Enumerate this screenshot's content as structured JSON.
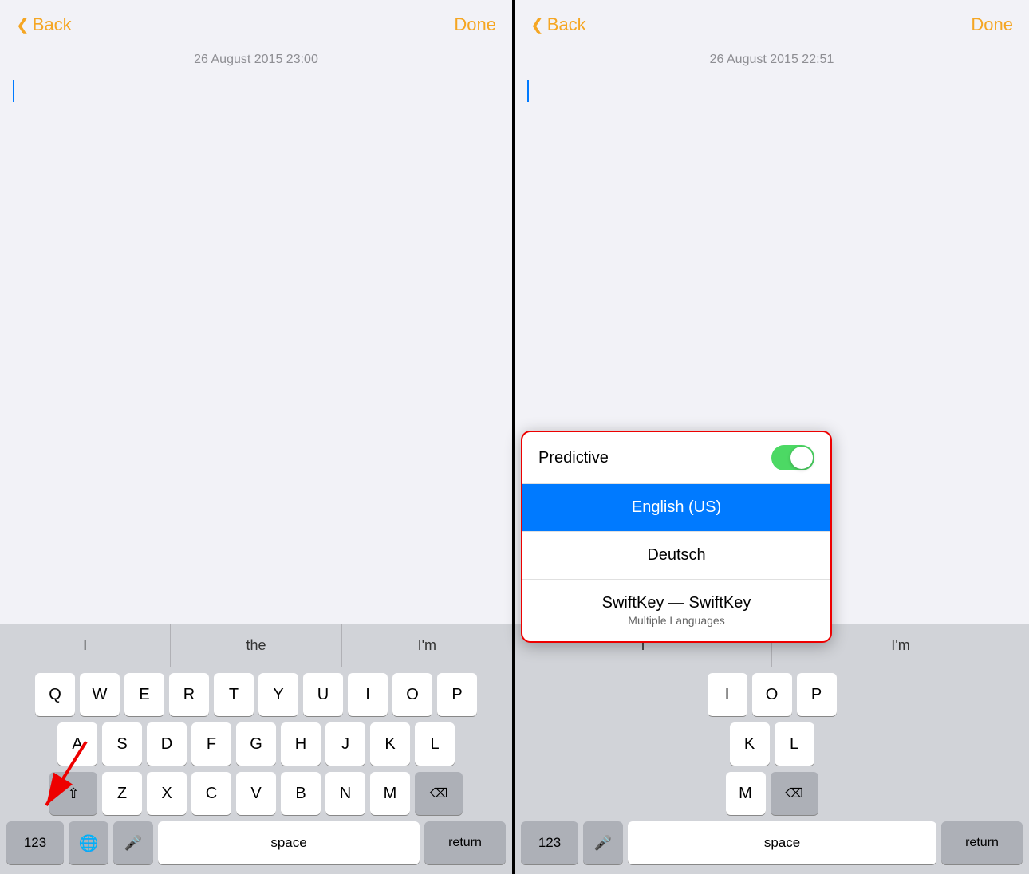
{
  "left_panel": {
    "back_label": "Back",
    "done_label": "Done",
    "date": "26 August 2015 23:00",
    "predictive_words": [
      "I",
      "the",
      "I'm"
    ],
    "keyboard_rows": [
      [
        "Q",
        "W",
        "E",
        "R",
        "T",
        "Y",
        "U",
        "I",
        "O",
        "P"
      ],
      [
        "A",
        "S",
        "D",
        "F",
        "G",
        "H",
        "J",
        "K",
        "L"
      ],
      [
        "Z",
        "X",
        "C",
        "V",
        "B",
        "N",
        "M"
      ]
    ],
    "bottom_keys": {
      "numbers": "123",
      "space": "space",
      "return": "return"
    }
  },
  "right_panel": {
    "back_label": "Back",
    "done_label": "Done",
    "date": "26 August 2015 22:51",
    "predictive_words": [
      "I",
      "I'm"
    ],
    "keyboard_rows": [
      [
        "I",
        "O",
        "P"
      ],
      [
        "K",
        "L"
      ],
      [
        "M"
      ]
    ],
    "bottom_keys": {
      "numbers": "123",
      "space": "space",
      "return": "return"
    },
    "popup": {
      "predictive_label": "Predictive",
      "toggle_on": true,
      "languages": [
        {
          "name": "English (US)",
          "sub": "",
          "active": true
        },
        {
          "name": "Deutsch",
          "sub": "",
          "active": false
        },
        {
          "name": "SwiftKey — SwiftKey",
          "sub": "Multiple Languages",
          "active": false
        }
      ]
    }
  },
  "icons": {
    "chevron": "❮",
    "globe": "🌐",
    "mic": "🎤",
    "delete": "⌫",
    "shift": "⇧"
  }
}
